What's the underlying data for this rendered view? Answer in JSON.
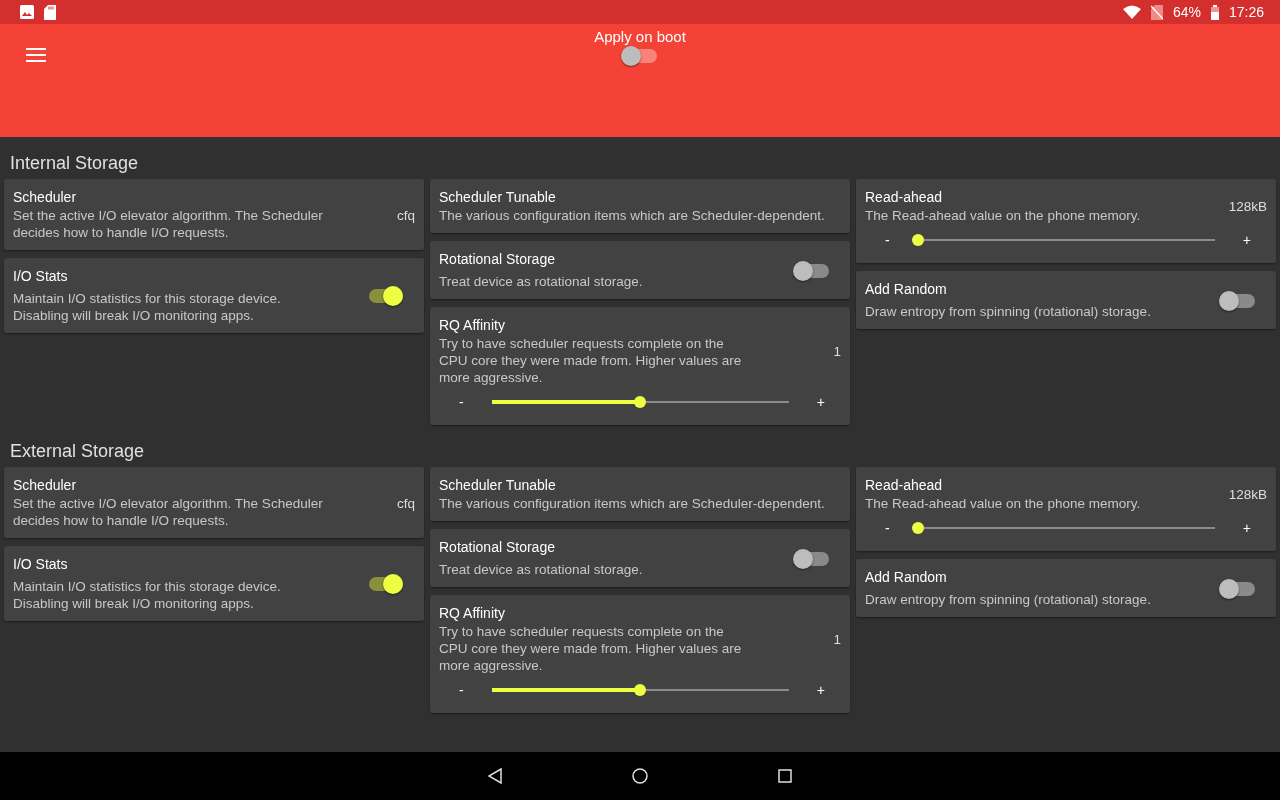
{
  "status_bar": {
    "battery": "64%",
    "time": "17:26"
  },
  "toolbar": {
    "apply_on_boot": {
      "label": "Apply on boot",
      "on": false
    }
  },
  "sections": [
    {
      "title": "Internal Storage",
      "columns": [
        [
          {
            "kind": "value",
            "title": "Scheduler",
            "description": "Set the active I/O elevator algorithm. The Scheduler decides how to handle I/O requests.",
            "value": "cfq"
          },
          {
            "kind": "switch",
            "title": "I/O Stats",
            "description": "Maintain I/O statistics for this storage device. Disabling will break I/O monitoring apps.",
            "on": true
          }
        ],
        [
          {
            "kind": "text",
            "title": "Scheduler Tunable",
            "description": "The various configuration items which are Scheduler-dependent."
          },
          {
            "kind": "switch",
            "title": "Rotational Storage",
            "description": "Treat device as rotational storage.",
            "on": false
          },
          {
            "kind": "slider",
            "title": "RQ Affinity",
            "description": "Try to have scheduler requests complete on the CPU core they were made from. Higher values are more aggressive.",
            "value": "1",
            "minus": "-",
            "plus": "+",
            "level": 0.5
          }
        ],
        [
          {
            "kind": "slider",
            "title": "Read-ahead",
            "description": "The Read-ahead value on the phone memory.",
            "value": "128kB",
            "minus": "-",
            "plus": "+",
            "level": 0.0
          },
          {
            "kind": "switch",
            "title": "Add Random",
            "description": "Draw entropy from spinning (rotational) storage.",
            "on": false
          }
        ]
      ]
    },
    {
      "title": "External Storage",
      "columns": [
        [
          {
            "kind": "value",
            "title": "Scheduler",
            "description": "Set the active I/O elevator algorithm. The Scheduler decides how to handle I/O requests.",
            "value": "cfq"
          },
          {
            "kind": "switch",
            "title": "I/O Stats",
            "description": "Maintain I/O statistics for this storage device. Disabling will break I/O monitoring apps.",
            "on": true
          }
        ],
        [
          {
            "kind": "text",
            "title": "Scheduler Tunable",
            "description": "The various configuration items which are Scheduler-dependent."
          },
          {
            "kind": "switch",
            "title": "Rotational Storage",
            "description": "Treat device as rotational storage.",
            "on": false
          },
          {
            "kind": "slider",
            "title": "RQ Affinity",
            "description": "Try to have scheduler requests complete on the CPU core they were made from. Higher values are more aggressive.",
            "value": "1",
            "minus": "-",
            "plus": "+",
            "level": 0.5
          }
        ],
        [
          {
            "kind": "slider",
            "title": "Read-ahead",
            "description": "The Read-ahead value on the phone memory.",
            "value": "128kB",
            "minus": "-",
            "plus": "+",
            "level": 0.0
          },
          {
            "kind": "switch",
            "title": "Add Random",
            "description": "Draw entropy from spinning (rotational) storage.",
            "on": false
          }
        ]
      ]
    }
  ]
}
